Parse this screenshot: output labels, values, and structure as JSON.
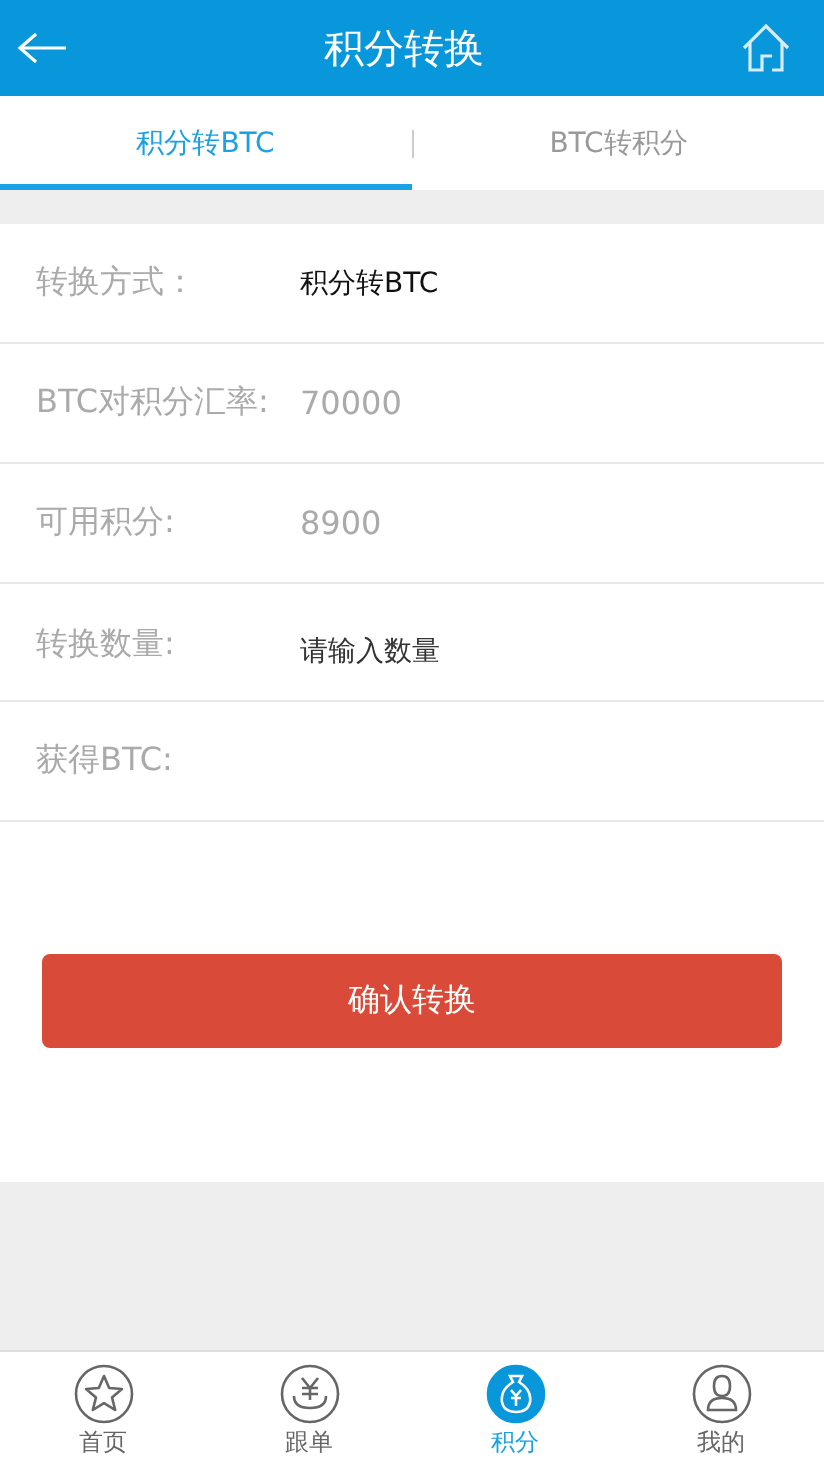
{
  "header": {
    "title": "积分转换"
  },
  "tabs": [
    {
      "label": "积分转BTC",
      "selected": true
    },
    {
      "label": "BTC转积分",
      "selected": false
    }
  ],
  "form": [
    {
      "kind": "choice",
      "label": "转换方式：",
      "value": "积分转BTC"
    },
    {
      "kind": "text",
      "label": "BTC对积分汇率:",
      "value": "70000"
    },
    {
      "kind": "text",
      "label": "可用积分:",
      "value": "8900"
    },
    {
      "kind": "input",
      "label": "转换数量:",
      "placeholder": "请输入数量"
    },
    {
      "kind": "text",
      "label": "获得BTC:"
    }
  ],
  "confirm_button": "确认转换",
  "nav": [
    {
      "label": "首页",
      "selected": false
    },
    {
      "label": "跟单",
      "selected": false
    },
    {
      "label": "积分",
      "selected": true
    },
    {
      "label": "我的",
      "selected": false
    }
  ]
}
